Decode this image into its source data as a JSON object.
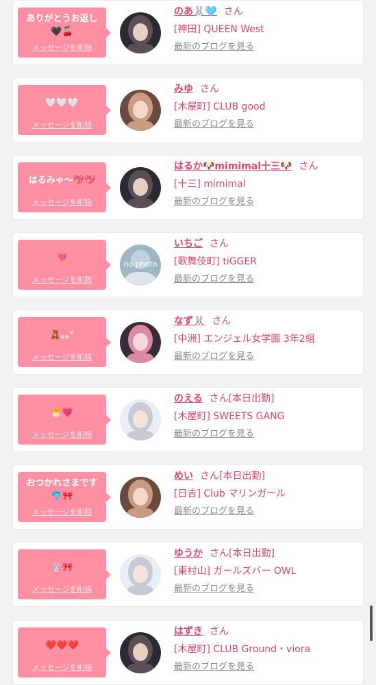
{
  "entries": [
    {
      "message": "ありがとうお返し\n🖤🍒",
      "delete_label": "メッセージを削除",
      "name": "のあ🐰🩵",
      "honorific": "さん",
      "status": "",
      "shop": "[神田] QUEEN West",
      "blog_link": "最新のブログを見る",
      "avatar": "dark"
    },
    {
      "message": "🤍🤍🤍",
      "delete_label": "メッセージを削除",
      "name": "みゆ",
      "honorific": "さん",
      "status": "",
      "shop": "[木屋町] CLUB good",
      "blog_link": "最新のブログを見る",
      "avatar": "warm"
    },
    {
      "message": "はるみゃ〜💖💖",
      "delete_label": "メッセージを削除",
      "name": "はるか🐶mimimal十三🐶",
      "honorific": "さん",
      "status": "",
      "shop": "[十三] mimimal",
      "blog_link": "最新のブログを見る",
      "avatar": "dark"
    },
    {
      "message": "💘",
      "delete_label": "メッセージを削除",
      "name": "いちご",
      "honorific": "さん",
      "status": "",
      "shop": "[歌舞伎町] tiGGER",
      "blog_link": "最新のブログを見る",
      "avatar": "nophoto"
    },
    {
      "message": "🧸｡｡°",
      "delete_label": "メッセージを削除",
      "name": "なず🐰",
      "honorific": "さん",
      "status": "",
      "shop": "[中洲] エンジェル女学園 3年2組",
      "blog_link": "最新のブログを見る",
      "avatar": "pink"
    },
    {
      "message": "🐣💗",
      "delete_label": "メッセージを削除",
      "name": "のえる",
      "honorific": "さん",
      "status": "[本日出勤]",
      "shop": "[木屋町] SWEETS GANG",
      "blog_link": "最新のブログを見る",
      "avatar": "light"
    },
    {
      "message": "おつかれさまです\n🐬🎀",
      "delete_label": "メッセージを削除",
      "name": "めい",
      "honorific": "さん",
      "status": "[本日出勤]",
      "shop": "[日吉] Club マリンガール",
      "blog_link": "最新のブログを見る",
      "avatar": "warm"
    },
    {
      "message": "🐰🎀",
      "delete_label": "メッセージを削除",
      "name": "ゆうか",
      "honorific": "さん",
      "status": "[本日出勤]",
      "shop": "[東村山] ガールズバー OWL",
      "blog_link": "最新のブログを見る",
      "avatar": "light"
    },
    {
      "message": "❤️❤️❤️",
      "delete_label": "メッセージを削除",
      "name": "はずき",
      "honorific": "さん",
      "status": "",
      "shop": "[木屋町] CLUB Ground・viora",
      "blog_link": "最新のブログを見る",
      "avatar": "dark"
    }
  ],
  "nophoto_text": "no photo",
  "colors": {
    "bubble": "#ff8fa3",
    "accent": "#e4436b",
    "background": "#f2f2f4"
  }
}
